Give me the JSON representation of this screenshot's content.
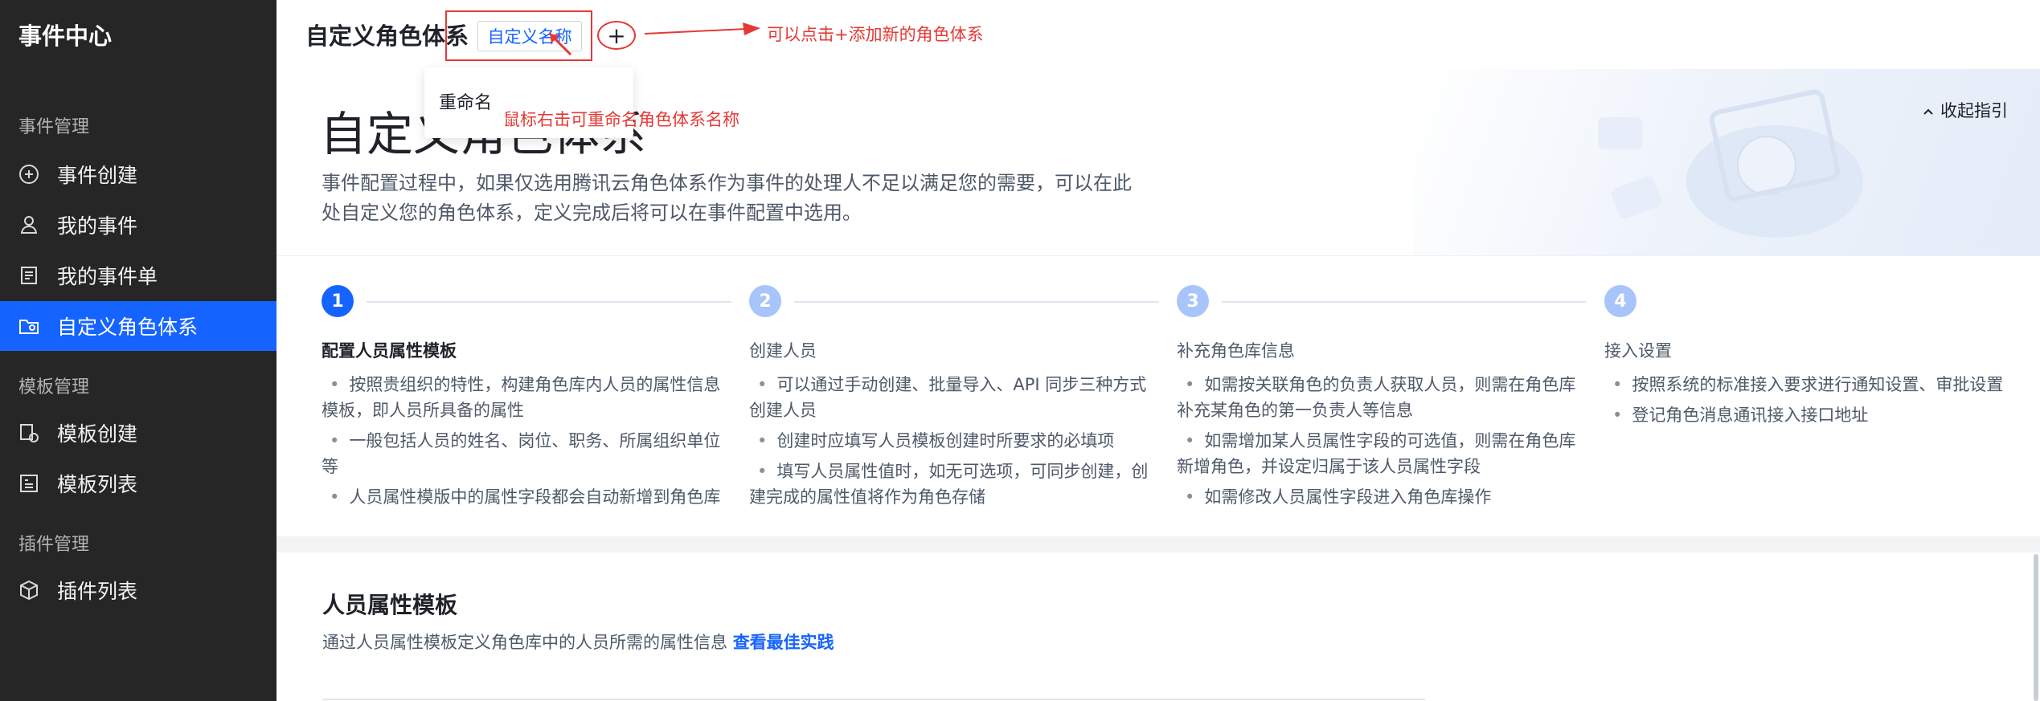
{
  "sidebar": {
    "brand": "事件中心",
    "sections": [
      {
        "title": "事件管理",
        "items": [
          {
            "label": "事件创建",
            "icon": "plus-circle-icon"
          },
          {
            "label": "我的事件",
            "icon": "user-icon"
          },
          {
            "label": "我的事件单",
            "icon": "list-doc-icon"
          },
          {
            "label": "自定义角色体系",
            "icon": "role-folder-icon",
            "active": true
          }
        ]
      },
      {
        "title": "模板管理",
        "items": [
          {
            "label": "模板创建",
            "icon": "template-create-icon"
          },
          {
            "label": "模板列表",
            "icon": "template-list-icon"
          }
        ]
      },
      {
        "title": "插件管理",
        "items": [
          {
            "label": "插件列表",
            "icon": "cube-icon"
          }
        ]
      }
    ]
  },
  "header": {
    "title": "自定义角色体系",
    "tab_label": "自定义名称",
    "add_symbol": "+"
  },
  "annotations": {
    "add_hint": "可以点击+添加新的角色体系",
    "rename_hint": "鼠标右击可重命名角色体系名称",
    "color": "#e53935"
  },
  "context_menu": {
    "rename": "重命名"
  },
  "banner": {
    "title": "自定义角色体系",
    "description": "事件配置过程中，如果仅选用腾讯云角色体系作为事件的处理人不足以满足您的需要，可以在此处自定义您的角色体系，定义完成后将可以在事件配置中选用。",
    "collapse": "收起指引"
  },
  "steps": [
    {
      "num": "1",
      "title": "配置人员属性模板",
      "state": "current",
      "bullets": [
        "按照贵组织的特性，构建角色库内人员的属性信息模板，即人员所具备的属性",
        "一般包括人员的姓名、岗位、职务、所属组织单位等",
        "人员属性模版中的属性字段都会自动新增到角色库"
      ]
    },
    {
      "num": "2",
      "title": "创建人员",
      "state": "todo",
      "bullets": [
        "可以通过手动创建、批量导入、API 同步三种方式创建人员",
        "创建时应填写人员模板创建时所要求的必填项",
        "填写人员属性值时，如无可选项，可同步创建，创建完成的属性值将作为角色存储"
      ]
    },
    {
      "num": "3",
      "title": "补充角色库信息",
      "state": "todo",
      "bullets": [
        "如需按关联角色的负责人获取人员，则需在角色库补充某角色的第一负责人等信息",
        "如需增加某人员属性字段的可选值，则需在角色库新增角色，并设定归属于该人员属性字段",
        "如需修改人员属性字段进入角色库操作"
      ]
    },
    {
      "num": "4",
      "title": "接入设置",
      "state": "todo",
      "bullets": [
        "按照系统的标准接入要求进行通知设置、审批设置",
        "登记角色消息通讯接入接口地址"
      ]
    }
  ],
  "section": {
    "title": "人员属性模板",
    "description": "通过人员属性模板定义角色库中的人员所需的属性信息",
    "link": "查看最佳实践"
  },
  "colors": {
    "primary": "#1664ff",
    "sidebar_bg": "#262626"
  }
}
